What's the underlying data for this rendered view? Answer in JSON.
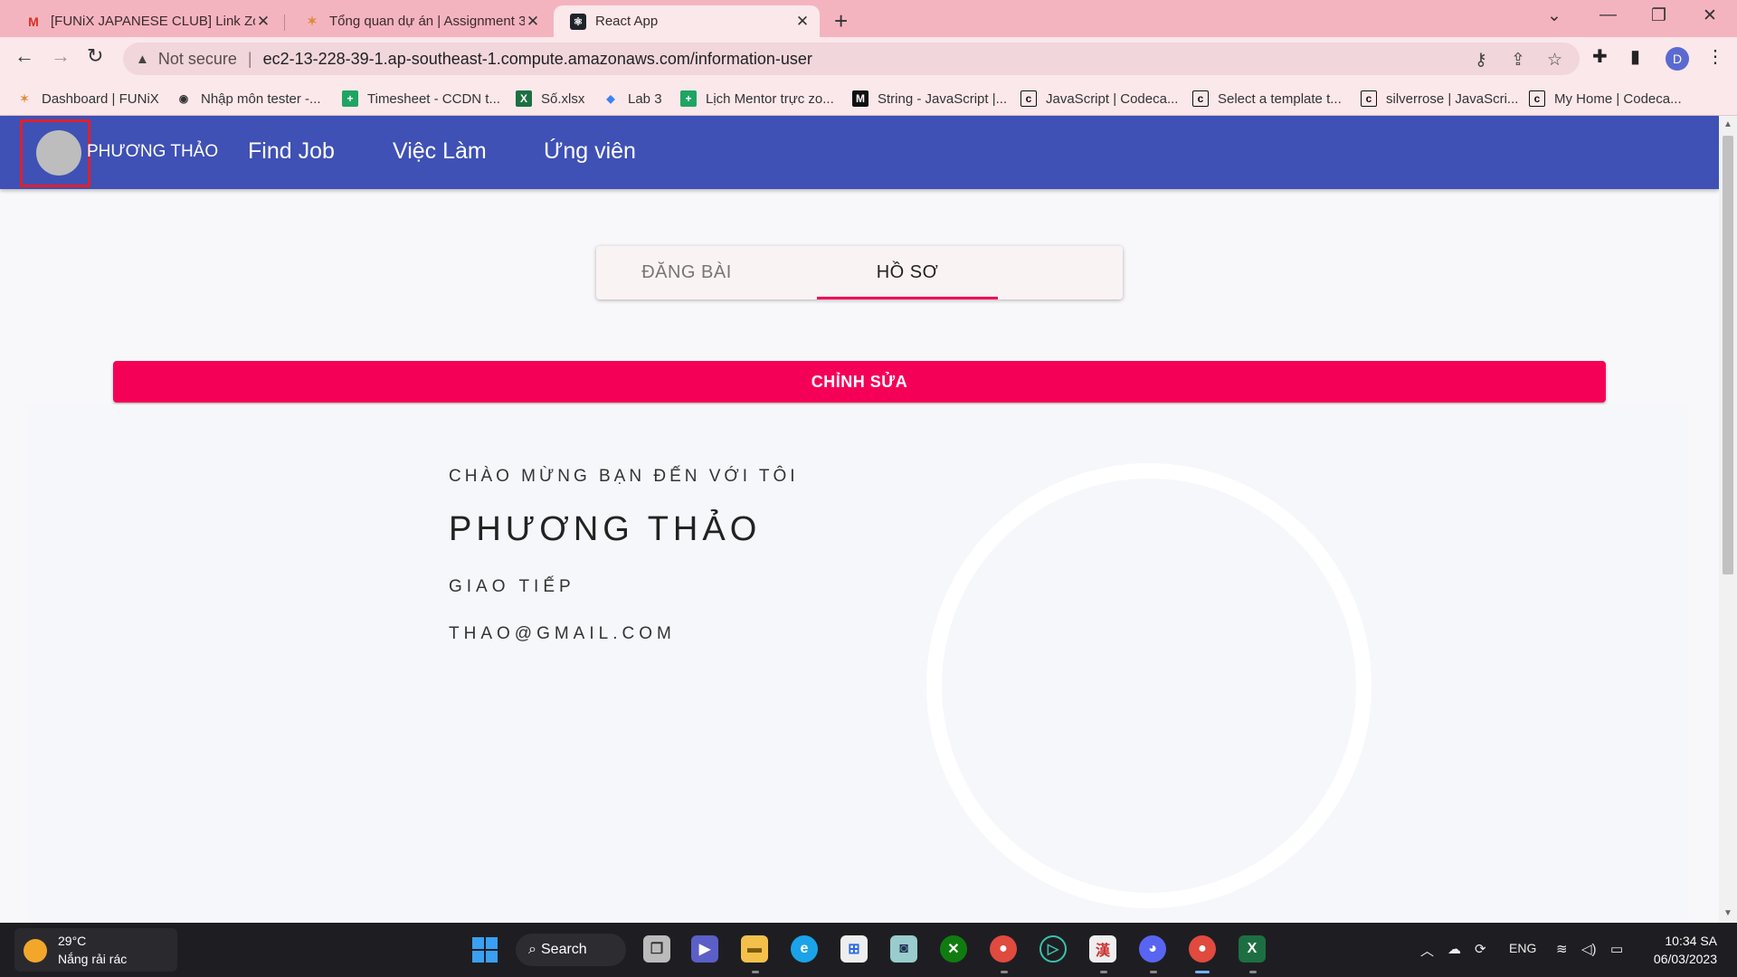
{
  "browser": {
    "tabs": [
      {
        "title": "[FUNiX JAPANESE CLUB] Link Zoom",
        "icon": "gmail-icon"
      },
      {
        "title": "Tổng quan dự án | Assignment 3",
        "icon": "funix-icon"
      },
      {
        "title": "React App",
        "icon": "react-icon"
      }
    ],
    "address": {
      "security": "Not secure",
      "url": "ec2-13-228-39-1.ap-southeast-1.compute.amazonaws.com/information-user"
    },
    "profile_initial": "D",
    "bookmarks": [
      "Dashboard | FUNiX",
      "Nhập môn tester -...",
      "Timesheet - CCDN t...",
      "Số.xlsx",
      "Lab 3",
      "Lịch Mentor trực zo...",
      "String - JavaScript |...",
      "JavaScript | Codeca...",
      "Select a template t...",
      "silverrose | JavaScri...",
      "My Home | Codeca..."
    ]
  },
  "app": {
    "nav": {
      "brand": "PHƯƠNG THẢO",
      "links": [
        "Find Job",
        "Việc Làm",
        "Ứng viên"
      ]
    },
    "tabs": {
      "post": "ĐĂNG BÀI",
      "profile": "HỒ SƠ",
      "selected": "profile"
    },
    "edit_button": "CHỈNH SỬA",
    "profile": {
      "welcome": "CHÀO MỪNG BẠN ĐẾN VỚI TÔI",
      "name": "PHƯƠNG THẢO",
      "job": "GIAO TIẾP",
      "email": "THAO@GMAIL.COM"
    }
  },
  "taskbar": {
    "weather": {
      "temp": "29°C",
      "desc": "Nắng rải rác"
    },
    "search": "Search",
    "lang": "ENG",
    "time": "10:34 SA",
    "date": "06/03/2023"
  },
  "colors": {
    "nav": "#3f51b5",
    "accent": "#f50057",
    "tabstrip": "#f4b4bf"
  }
}
